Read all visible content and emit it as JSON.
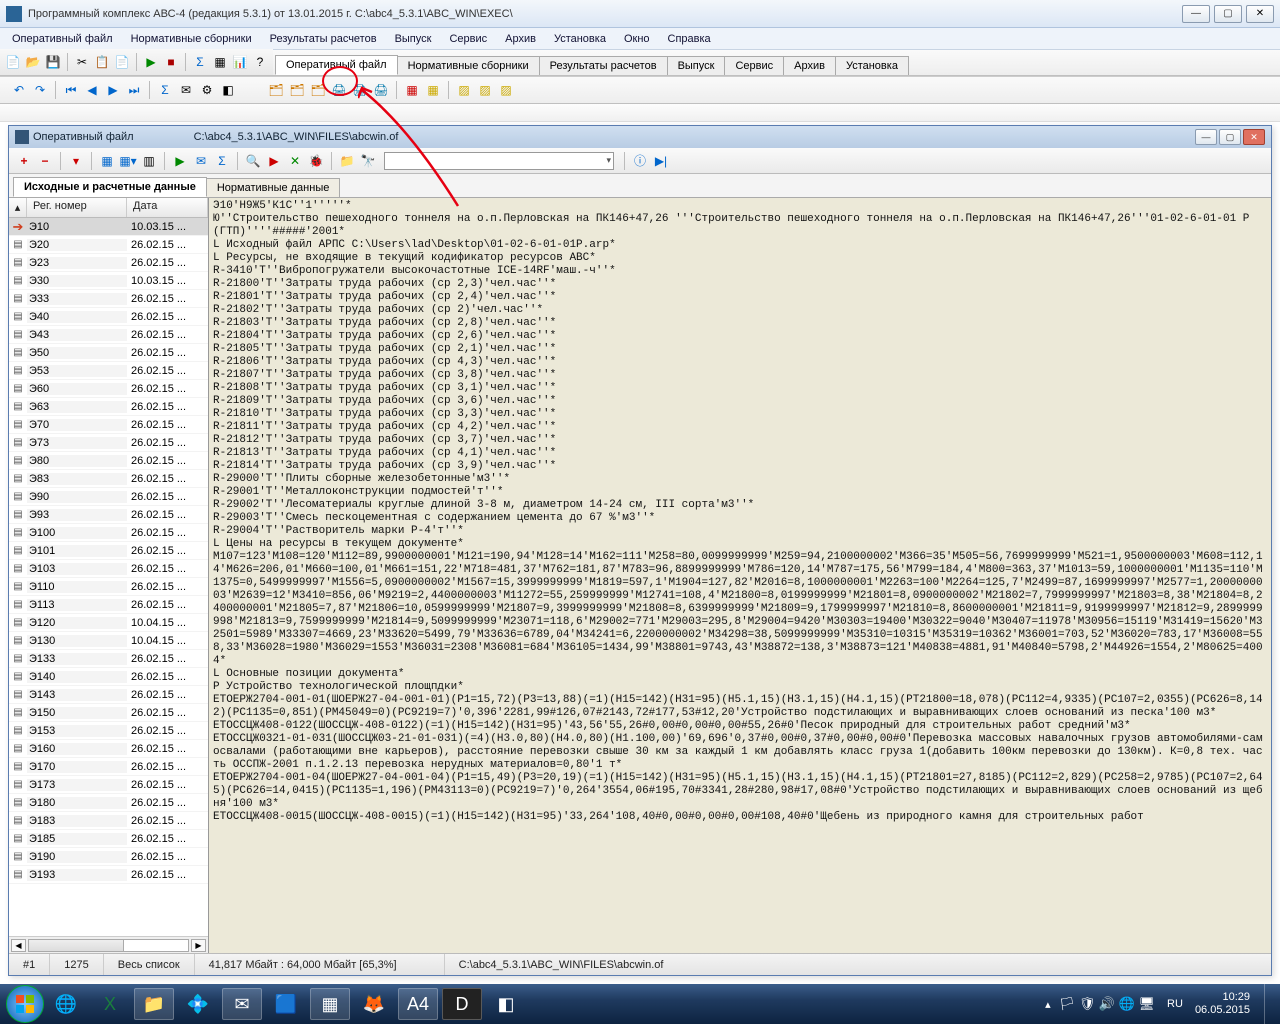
{
  "app": {
    "title": "Программный комплекс АВС-4 (редакция 5.3.1) от 13.01.2015 г.      C:\\abc4_5.3.1\\ABC_WIN\\EXEC\\"
  },
  "menu": {
    "items": [
      "Оперативный файл",
      "Нормативные сборники",
      "Результаты расчетов",
      "Выпуск",
      "Сервис",
      "Архив",
      "Установка",
      "Окно",
      "Справка"
    ]
  },
  "main_tabs": {
    "items": [
      "Оперативный файл",
      "Нормативные сборники",
      "Результаты расчетов",
      "Выпуск",
      "Сервис",
      "Архив",
      "Установка"
    ],
    "active": 0
  },
  "child": {
    "title": "Оперативный файл",
    "path": "C:\\abc4_5.3.1\\ABC_WIN\\FILES\\abcwin.of"
  },
  "inner_tabs": {
    "items": [
      "Исходные и расчетные данные",
      "Нормативные данные"
    ],
    "active": 0
  },
  "list": {
    "header_col1": "Рег. номер",
    "header_col2": "Дата",
    "rows": [
      {
        "num": "Э10",
        "date": "10.03.15 ...",
        "arrow": true
      },
      {
        "num": "Э20",
        "date": "26.02.15 ..."
      },
      {
        "num": "Э23",
        "date": "26.02.15 ..."
      },
      {
        "num": "Э30",
        "date": "10.03.15 ..."
      },
      {
        "num": "Э33",
        "date": "26.02.15 ..."
      },
      {
        "num": "Э40",
        "date": "26.02.15 ..."
      },
      {
        "num": "Э43",
        "date": "26.02.15 ..."
      },
      {
        "num": "Э50",
        "date": "26.02.15 ..."
      },
      {
        "num": "Э53",
        "date": "26.02.15 ..."
      },
      {
        "num": "Э60",
        "date": "26.02.15 ..."
      },
      {
        "num": "Э63",
        "date": "26.02.15 ..."
      },
      {
        "num": "Э70",
        "date": "26.02.15 ..."
      },
      {
        "num": "Э73",
        "date": "26.02.15 ..."
      },
      {
        "num": "Э80",
        "date": "26.02.15 ..."
      },
      {
        "num": "Э83",
        "date": "26.02.15 ..."
      },
      {
        "num": "Э90",
        "date": "26.02.15 ..."
      },
      {
        "num": "Э93",
        "date": "26.02.15 ..."
      },
      {
        "num": "Э100",
        "date": "26.02.15 ..."
      },
      {
        "num": "Э101",
        "date": "26.02.15 ..."
      },
      {
        "num": "Э103",
        "date": "26.02.15 ..."
      },
      {
        "num": "Э110",
        "date": "26.02.15 ..."
      },
      {
        "num": "Э113",
        "date": "26.02.15 ..."
      },
      {
        "num": "Э120",
        "date": "10.04.15 ..."
      },
      {
        "num": "Э130",
        "date": "10.04.15 ..."
      },
      {
        "num": "Э133",
        "date": "26.02.15 ..."
      },
      {
        "num": "Э140",
        "date": "26.02.15 ..."
      },
      {
        "num": "Э143",
        "date": "26.02.15 ..."
      },
      {
        "num": "Э150",
        "date": "26.02.15 ..."
      },
      {
        "num": "Э153",
        "date": "26.02.15 ..."
      },
      {
        "num": "Э160",
        "date": "26.02.15 ..."
      },
      {
        "num": "Э170",
        "date": "26.02.15 ..."
      },
      {
        "num": "Э173",
        "date": "26.02.15 ..."
      },
      {
        "num": "Э180",
        "date": "26.02.15 ..."
      },
      {
        "num": "Э183",
        "date": "26.02.15 ..."
      },
      {
        "num": "Э185",
        "date": "26.02.15 ..."
      },
      {
        "num": "Э190",
        "date": "26.02.15 ..."
      },
      {
        "num": "Э193",
        "date": "26.02.15 ..."
      }
    ]
  },
  "document_lines": [
    "Э10'Н9Ж5'К1С''1'''''*",
    "Ю''Строительство пешеходного тоннеля на о.п.Перловская на ПК146+47,26 '''Строительство пешеходного тоннеля на о.п.Перловская на ПК146+47,26'''01-02-6-01-01 Р (ГТП)''''#####'2001*",
    "L Исходный файл АРПС C:\\Users\\lad\\Desktop\\01-02-6-01-01Р.arp*",
    "L Ресурсы, не входящие в текущий кодификатор ресурсов АВС*",
    "R-3410'Т''Вибропогружатели высокочастотные ICE-14RF'маш.-ч''*",
    "R-21800'Т''Затраты труда рабочих (ср 2,3)'чел.час''*",
    "R-21801'Т''Затраты труда рабочих (ср 2,4)'чел.час''*",
    "R-21802'Т''Затраты труда рабочих (ср 2)'чел.час''*",
    "R-21803'Т''Затраты труда рабочих (ср 2,8)'чел.час''*",
    "R-21804'Т''Затраты труда рабочих (ср 2,6)'чел.час''*",
    "R-21805'Т''Затраты труда рабочих (ср 2,1)'чел.час''*",
    "R-21806'Т''Затраты труда рабочих (ср 4,3)'чел.час''*",
    "R-21807'Т''Затраты труда рабочих (ср 3,8)'чел.час''*",
    "R-21808'Т''Затраты труда рабочих (ср 3,1)'чел.час''*",
    "R-21809'Т''Затраты труда рабочих (ср 3,6)'чел.час''*",
    "R-21810'Т''Затраты труда рабочих (ср 3,3)'чел.час''*",
    "R-21811'Т''Затраты труда рабочих (ср 4,2)'чел.час''*",
    "R-21812'Т''Затраты труда рабочих (ср 3,7)'чел.час''*",
    "R-21813'Т''Затраты труда рабочих (ср 4,1)'чел.час''*",
    "R-21814'Т''Затраты труда рабочих (ср 3,9)'чел.час''*",
    "R-29000'Т''Плиты сборные железобетонные'м3''*",
    "R-29001'Т''Металлоконструкции подмостей'т''*",
    "R-29002'Т''Лесоматериалы круглые длиной 3-8 м, диаметром 14-24 см, III сорта'м3''*",
    "R-29003'Т''Смесь пескоцементная с содержанием цемента до 67 %'м3''*",
    "R-29004'Т''Растворитель марки Р-4'т''*",
    "L Цены на ресурсы в текущем документе*",
    "М107=123'М108=120'М112=89,9900000001'М121=190,94'М128=14'М162=111'М258=80,0099999999'М259=94,2100000002'М366=35'М505=56,7699999999'М521=1,9500000003'М608=112,14'М626=206,01'М660=100,01'М661=151,22'М718=481,37'М762=181,87'М783=96,8899999999'М786=120,14'М787=175,56'М799=184,4'М800=363,37'М1013=59,1000000001'М1135=110'М1375=0,5499999997'М1556=5,0900000002'М1567=15,3999999999'М1819=597,1'М1904=127,82'М2016=8,1000000001'М2263=100'М2264=125,7'М2499=87,1699999997'М2577=1,2000000003'М2639=12'М3410=856,06'М9219=2,4400000003'М11272=55,259999999'М12741=108,4'М21800=8,0199999999'М21801=8,0900000002'М21802=7,7999999997'М21803=8,38'М21804=8,2400000001'М21805=7,87'М21806=10,0599999999'М21807=9,3999999999'М21808=8,6399999999'М21809=9,1799999997'М21810=8,8600000001'М21811=9,9199999997'М21812=9,2899999998'М21813=9,7599999999'М21814=9,5099999999'М23071=118,6'М29002=771'М29003=295,8'М29004=9420'М30303=19400'М30322=9040'М30407=11978'М30956=15119'М31419=15620'М32501=5989'М33307=4669,23'М33620=5499,79'М33636=6789,04'М34241=6,2200000002'М34298=38,5099999999'М35310=10315'М35319=10362'М36001=703,52'М36020=783,17'М36008=558,33'М36028=1980'М36029=1553'М36031=2308'М36081=684'М36105=1434,99'М38801=9743,43'М38872=138,3'М38873=121'М40838=4881,91'М40840=5798,2'М44926=1554,2'М80625=4004*",
    "L Основные позиции документа*",
    "Р Устройство технологической площпдки*",
    "ЕТОЕРЖ2704-001-01(ШОЕРЖ27-04-001-01)(Р1=15,72)(Р3=13,88)(=1)(Н15=142)(Н31=95)(Н5.1,15)(Н3.1,15)(Н4.1,15)(РТ21800=18,078)(РС112=4,9335)(РС107=2,0355)(РС626=8,142)(РС1135=0,851)(РМ45049=0)(РС9219=7)'0,396'2281,99#126,07#2143,72#177,53#12,20'Устройство подстилающих и выравнивающих слоев оснований из песка'100 м3*",
    "ЕТОССЦЖ408-0122(ШОССЦЖ-408-0122)(=1)(Н15=142)(Н31=95)'43,56'55,26#0,00#0,00#0,00#55,26#0'Песок природный для строительных работ средний'м3*",
    "ЕТОССЦЖ0321-01-031(ШОССЦЖ03-21-01-031)(=4)(Н3.0,80)(Н4.0,80)(Н1.100,00)'69,696'0,37#0,00#0,37#0,00#0,00#0'Перевозка массовых навалочных грузов автомобилями-самосвалами (работающими вне карьеров), расстояние перевозки свыше 30 км за каждый 1 км добавлять класс груза 1(добавить 100км перевозки до 130км). К=0,8 тех. часть ОССПЖ-2001 п.1.2.13 перевозка нерудных материалов=0,80'1 т*",
    "ЕТОЕРЖ2704-001-04(ШОЕРЖ27-04-001-04)(Р1=15,49)(Р3=20,19)(=1)(Н15=142)(Н31=95)(Н5.1,15)(Н3.1,15)(Н4.1,15)(РТ21801=27,8185)(РС112=2,829)(РС258=2,9785)(РС107=2,645)(РС626=14,0415)(РС1135=1,196)(РМ43113=0)(РС9219=7)'0,264'3554,06#195,70#3341,28#280,98#17,08#0'Устройство подстилающих и выравнивающих слоев оснований из щебня'100 м3*",
    "ЕТОССЦЖ408-0015(ШОССЦЖ-408-0015)(=1)(Н15=142)(Н31=95)'33,264'108,40#0,00#0,00#0,00#108,40#0'Щебень из природного камня для строительных работ"
  ],
  "status": {
    "cell1": "#1",
    "cell2": "1275",
    "cell3": "Весь список",
    "cell4": "41,817 Мбайт : 64,000 Мбайт  [65,3%]",
    "cell5": "C:\\abc4_5.3.1\\ABC_WIN\\FILES\\abcwin.of"
  },
  "tray": {
    "lang": "RU",
    "time": "10:29",
    "date": "06.05.2015"
  }
}
